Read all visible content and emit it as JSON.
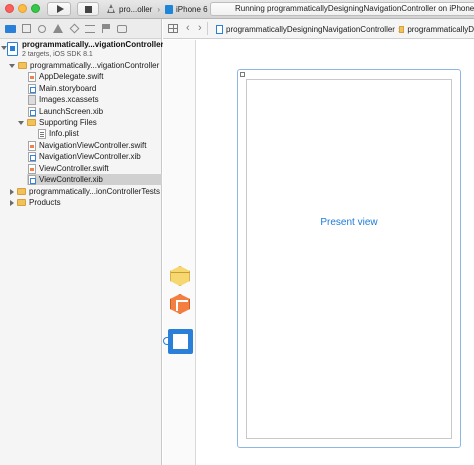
{
  "toolbar": {
    "scheme_app": "pro...oller",
    "scheme_device": "iPhone 6",
    "status": "Running programmaticallyDesigningNavigationController on iPhone 6"
  },
  "navigator": {
    "project": {
      "name": "programmatically...vigationController",
      "subtitle": "2 targets, iOS SDK 8.1"
    },
    "group_main": "programmatically...vigationController",
    "files": [
      "AppDelegate.swift",
      "Main.storyboard",
      "Images.xcassets",
      "LaunchScreen.xib"
    ],
    "supporting_group": "Supporting Files",
    "supporting_files": [
      "Info.plist"
    ],
    "files2": [
      "NavigationViewController.swift",
      "NavigationViewController.xib",
      "ViewController.swift",
      "ViewController.xib"
    ],
    "group_tests": "programmatically...ionControllerTests",
    "group_products": "Products"
  },
  "jumpbar": {
    "crumb1": "programmaticallyDesigningNavigationController",
    "crumb2": "programmaticallyD"
  },
  "canvas": {
    "view_label": "Present view"
  },
  "icons": {
    "accent": "#2a7fd8",
    "link_text": "#1b7bd8"
  }
}
